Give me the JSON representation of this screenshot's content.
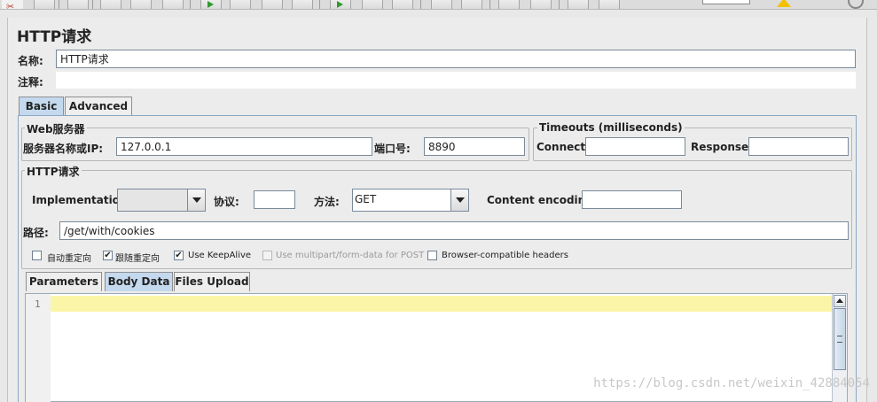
{
  "header": {
    "title": "HTTP请求"
  },
  "name_row": {
    "label": "名称:",
    "value": "HTTP请求"
  },
  "comment_row": {
    "label": "注释:"
  },
  "main_tabs": [
    {
      "label": "Basic",
      "active": true
    },
    {
      "label": "Advanced",
      "active": false
    }
  ],
  "web_server": {
    "legend": "Web服务器",
    "host_label": "服务器名称或IP:",
    "host_value": "127.0.0.1",
    "port_label": "端口号:",
    "port_value": "8890"
  },
  "timeouts": {
    "legend": "Timeouts (milliseconds)",
    "connect_label": "Connect:",
    "connect_value": "",
    "response_label": "Response:",
    "response_value": ""
  },
  "http_request": {
    "legend": "HTTP请求",
    "implementation_label": "Implementation:",
    "implementation_value": "",
    "protocol_label": "协议:",
    "protocol_value": "",
    "method_label": "方法:",
    "method_value": "GET",
    "encoding_label": "Content encoding:",
    "encoding_value": "",
    "path_label": "路径:",
    "path_value": "/get/with/cookies"
  },
  "options": [
    {
      "label": "自动重定向",
      "checked": false,
      "enabled": true
    },
    {
      "label": "跟随重定向",
      "checked": true,
      "enabled": true
    },
    {
      "label": "Use KeepAlive",
      "checked": true,
      "enabled": true
    },
    {
      "label": "Use multipart/form-data for POST",
      "checked": false,
      "enabled": false
    },
    {
      "label": "Browser-compatible headers",
      "checked": false,
      "enabled": true
    }
  ],
  "body_tabs": [
    {
      "label": "Parameters",
      "active": false
    },
    {
      "label": "Body Data",
      "active": true
    },
    {
      "label": "Files Upload",
      "active": false
    }
  ],
  "editor": {
    "line_number": "1",
    "content": ""
  },
  "watermark": "https://blog.csdn.net/weixin_42884054",
  "colors": {
    "active_tab": "#c4d9ee",
    "current_line": "#fbf6a7",
    "panel_bg": "#ececec"
  }
}
